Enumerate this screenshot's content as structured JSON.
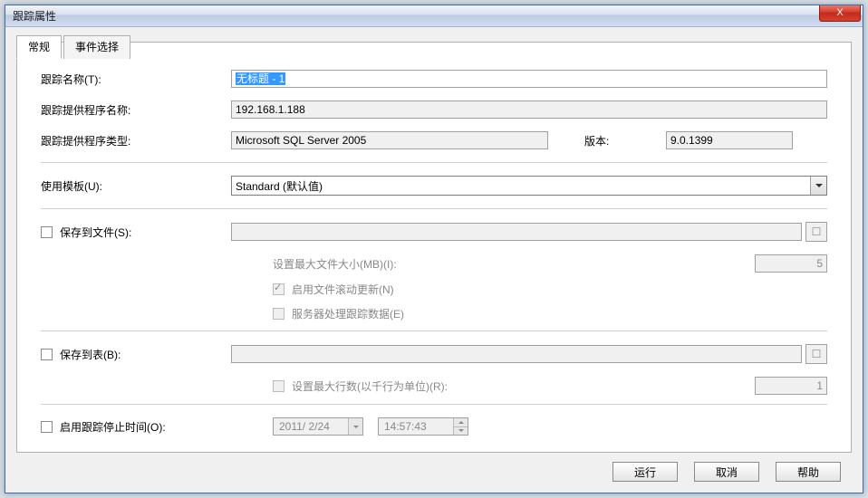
{
  "window": {
    "title": "跟踪属性"
  },
  "tabs": {
    "general": "常规",
    "event_select": "事件选择"
  },
  "fields": {
    "trace_name_label": "跟踪名称(T):",
    "trace_name_value": "无标题 - 1",
    "provider_name_label": "跟踪提供程序名称:",
    "provider_name_value": "192.168.1.188",
    "provider_type_label": "跟踪提供程序类型:",
    "provider_type_value": "Microsoft SQL Server 2005",
    "version_label": "版本:",
    "version_value": "9.0.1399",
    "template_label": "使用模板(U):",
    "template_value": "Standard (默认值)",
    "save_file_label": "保存到文件(S):",
    "max_file_size_label": "设置最大文件大小(MB)(I):",
    "max_file_size_value": "5",
    "enable_rollover_label": "启用文件滚动更新(N)",
    "server_process_label": "服务器处理跟踪数据(E)",
    "save_table_label": "保存到表(B):",
    "max_rows_label": "设置最大行数(以千行为单位)(R):",
    "max_rows_value": "1",
    "stop_time_label": "启用跟踪停止时间(O):",
    "stop_date_value": "2011/ 2/24",
    "stop_time_value": "14:57:43"
  },
  "buttons": {
    "run": "运行",
    "cancel": "取消",
    "help": "帮助",
    "close": "X"
  }
}
